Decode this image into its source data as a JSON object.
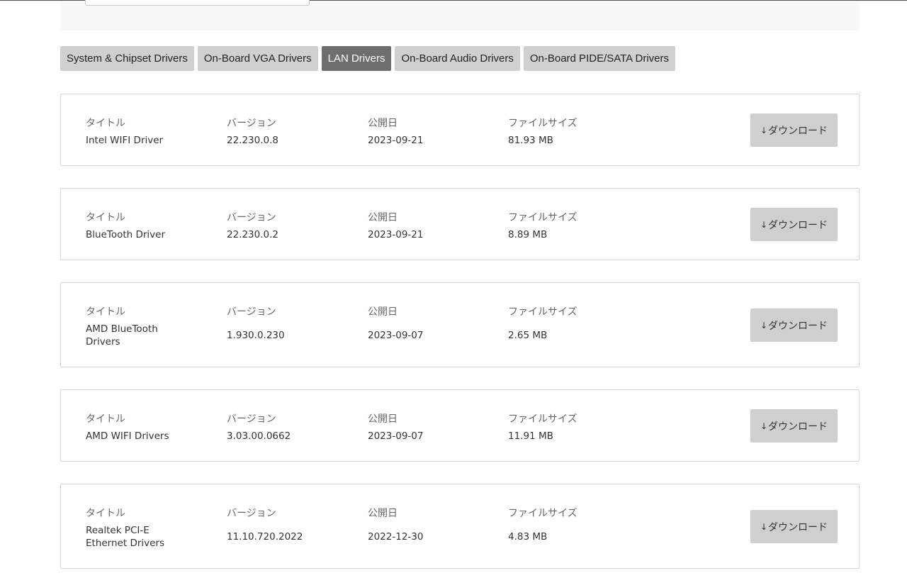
{
  "tabs": [
    {
      "label": "System & Chipset Drivers",
      "active": false
    },
    {
      "label": "On-Board VGA Drivers",
      "active": false
    },
    {
      "label": "LAN Drivers",
      "active": true
    },
    {
      "label": "On-Board Audio Drivers",
      "active": false
    },
    {
      "label": "On-Board PIDE/SATA Drivers",
      "active": false
    }
  ],
  "labels": {
    "title": "タイトル",
    "version": "バージョン",
    "date": "公開日",
    "size": "ファイルサイズ",
    "download": "ダウンロード",
    "download_icon": "↓"
  },
  "drivers": [
    {
      "title": "Intel WIFI Driver",
      "version": "22.230.0.8",
      "date": "2023-09-21",
      "size": "81.93 MB"
    },
    {
      "title": "BlueTooth Driver",
      "version": "22.230.0.2",
      "date": "2023-09-21",
      "size": "8.89 MB"
    },
    {
      "title": "AMD BlueTooth Drivers",
      "version": "1.930.0.230",
      "date": "2023-09-07",
      "size": "2.65 MB"
    },
    {
      "title": "AMD WIFI Drivers",
      "version": "3.03.00.0662",
      "date": "2023-09-07",
      "size": "11.91 MB"
    },
    {
      "title": "Realtek PCI-E Ethernet Drivers",
      "version": "11.10.720.2022",
      "date": "2022-12-30",
      "size": "4.83 MB"
    }
  ]
}
